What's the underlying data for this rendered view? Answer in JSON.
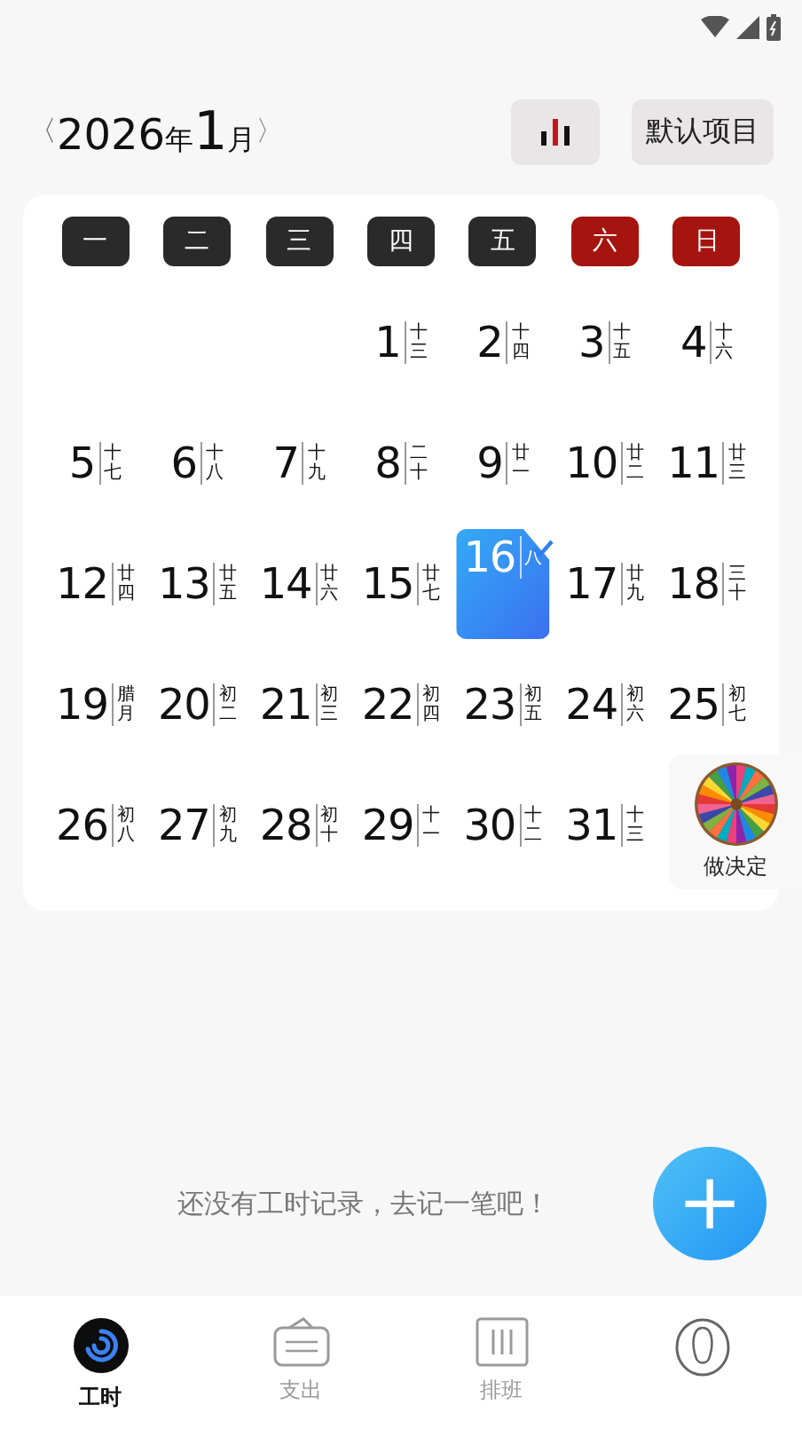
{
  "header": {
    "year": "2026",
    "year_unit": "年",
    "month": "1",
    "month_unit": "月",
    "prev": "〈",
    "next": "〉",
    "project_button": "默认项目"
  },
  "weekdays": [
    {
      "label": "一",
      "color": "#2a2a2a"
    },
    {
      "label": "二",
      "color": "#2a2a2a"
    },
    {
      "label": "三",
      "color": "#2a2a2a"
    },
    {
      "label": "四",
      "color": "#2a2a2a"
    },
    {
      "label": "五",
      "color": "#2a2a2a"
    },
    {
      "label": "六",
      "color": "#a5140f"
    },
    {
      "label": "日",
      "color": "#a5140f"
    }
  ],
  "days": [
    {
      "day": "1",
      "lunar": "十三",
      "selected": false
    },
    {
      "day": "2",
      "lunar": "十四",
      "selected": false
    },
    {
      "day": "3",
      "lunar": "十五",
      "selected": false
    },
    {
      "day": "4",
      "lunar": "十六",
      "selected": false
    },
    {
      "day": "5",
      "lunar": "十七",
      "selected": false
    },
    {
      "day": "6",
      "lunar": "十八",
      "selected": false
    },
    {
      "day": "7",
      "lunar": "十九",
      "selected": false
    },
    {
      "day": "8",
      "lunar": "二十",
      "selected": false
    },
    {
      "day": "9",
      "lunar": "廿一",
      "selected": false
    },
    {
      "day": "10",
      "lunar": "廿二",
      "selected": false
    },
    {
      "day": "11",
      "lunar": "廿三",
      "selected": false
    },
    {
      "day": "12",
      "lunar": "廿四",
      "selected": false
    },
    {
      "day": "13",
      "lunar": "廿五",
      "selected": false
    },
    {
      "day": "14",
      "lunar": "廿六",
      "selected": false
    },
    {
      "day": "15",
      "lunar": "廿七",
      "selected": false
    },
    {
      "day": "16",
      "lunar": "八",
      "selected": true
    },
    {
      "day": "17",
      "lunar": "廿九",
      "selected": false
    },
    {
      "day": "18",
      "lunar": "三十",
      "selected": false
    },
    {
      "day": "19",
      "lunar": "腊月",
      "selected": false
    },
    {
      "day": "20",
      "lunar": "初二",
      "selected": false
    },
    {
      "day": "21",
      "lunar": "初三",
      "selected": false
    },
    {
      "day": "22",
      "lunar": "初四",
      "selected": false
    },
    {
      "day": "23",
      "lunar": "初五",
      "selected": false
    },
    {
      "day": "24",
      "lunar": "初六",
      "selected": false
    },
    {
      "day": "25",
      "lunar": "初七",
      "selected": false
    },
    {
      "day": "26",
      "lunar": "初八",
      "selected": false
    },
    {
      "day": "27",
      "lunar": "初九",
      "selected": false
    },
    {
      "day": "28",
      "lunar": "初十",
      "selected": false
    },
    {
      "day": "29",
      "lunar": "十一",
      "selected": false
    },
    {
      "day": "30",
      "lunar": "十二",
      "selected": false
    },
    {
      "day": "31",
      "lunar": "十三",
      "selected": false
    }
  ],
  "decide_button": {
    "label": "做决定"
  },
  "empty_message": "还没有工时记录，去记一笔吧！",
  "fab": {
    "symbol": "+"
  },
  "nav": [
    {
      "kind": "hours",
      "label": "工时",
      "selected": true
    },
    {
      "kind": "expense",
      "label": "支出",
      "selected": false
    },
    {
      "kind": "schedule",
      "label": "排班",
      "selected": false
    },
    {
      "kind": "profile",
      "selected": false
    }
  ]
}
